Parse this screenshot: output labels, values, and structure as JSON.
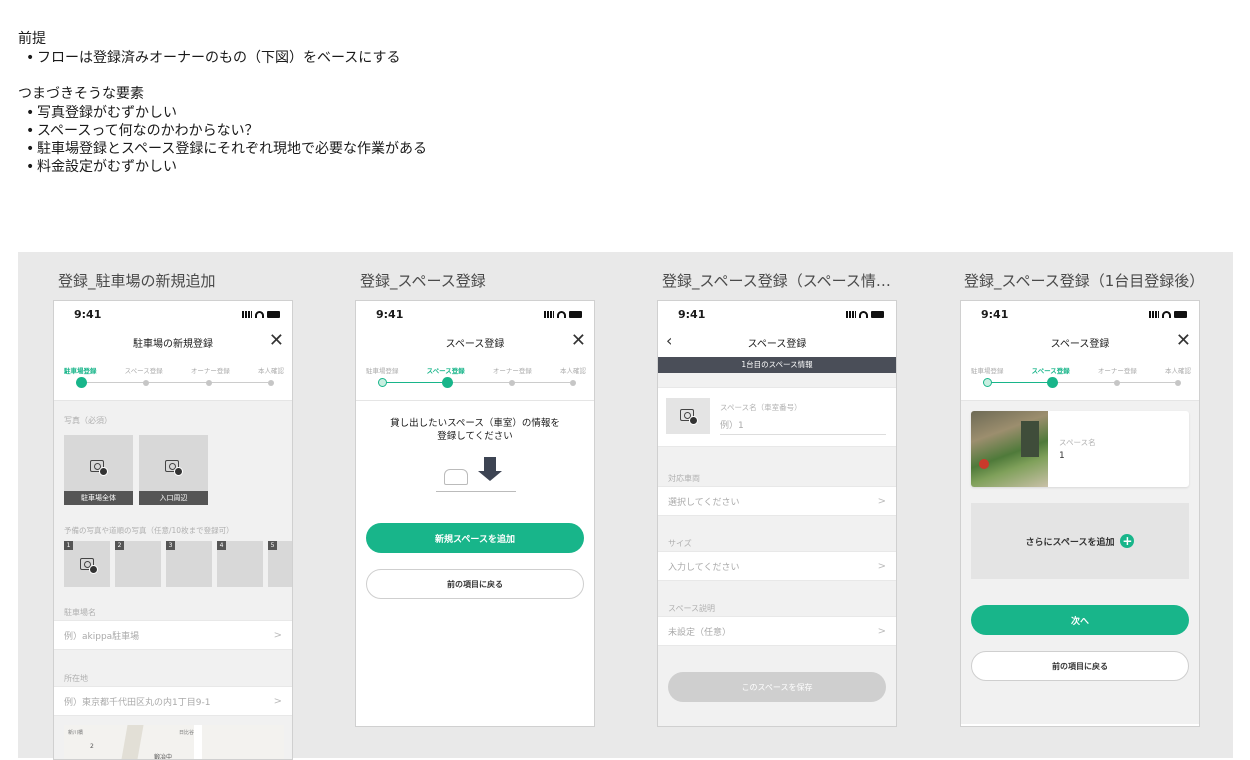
{
  "notes": {
    "premise_heading": "前提",
    "premise_items": [
      "フローは登録済みオーナーのもの（下図）をベースにする"
    ],
    "pitfalls_heading": "つまづきそうな要素",
    "pitfall_items": [
      "写真登録がむずかしい",
      "スペースって何なのかわからない？",
      "駐車場登録とスペース登録にそれぞれ現地で必要な作業がある",
      "料金設定がむずかしい"
    ]
  },
  "status_time": "9:41",
  "steps": [
    "駐車場登録",
    "スペース登録",
    "オーナー登録",
    "本人確認"
  ],
  "frames": {
    "f1": {
      "title": "登録_駐車場の新規追加",
      "nav_title": "駐車場の新規登録",
      "photo_label": "写真（必須）",
      "photo_caps": [
        "駐車場全体",
        "入口周辺"
      ],
      "extra_label": "予備の写真や道順の写真（任意/10枚まで登録可）",
      "nums": [
        "1",
        "2",
        "3",
        "4",
        "5"
      ],
      "name_label": "駐車場名",
      "name_placeholder": "例）akippa駐車場",
      "addr_label": "所在地",
      "addr_placeholder": "例）東京都千代田区丸の内1丁目9-1",
      "map_text": [
        "新川橋",
        "2",
        "日比谷",
        "鍛冶中"
      ]
    },
    "f2": {
      "title": "登録_スペース登録",
      "nav_title": "スペース登録",
      "message": "貸し出したいスペース（車室）の情報を\n登録してください",
      "add_button": "新規スペースを追加",
      "back_button": "前の項目に戻る"
    },
    "f3": {
      "title": "登録_スペース登録（スペース情…",
      "nav_title": "スペース登録",
      "banner": "1台目のスペース情報",
      "space_name_label": "スペース名（車室番号）",
      "space_name_placeholder": "例）1",
      "vehicle_label": "対応車両",
      "vehicle_placeholder": "選択してください",
      "size_label": "サイズ",
      "size_placeholder": "入力してください",
      "desc_label": "スペース説明",
      "desc_placeholder": "未設定（任意）",
      "save_button": "このスペースを保存"
    },
    "f4": {
      "title": "登録_スペース登録（1台目登録後）",
      "nav_title": "スペース登録",
      "card_label": "スペース名",
      "card_value": "1",
      "more_button": "さらにスペースを追加",
      "next_button": "次へ",
      "back_button": "前の項目に戻る"
    }
  }
}
